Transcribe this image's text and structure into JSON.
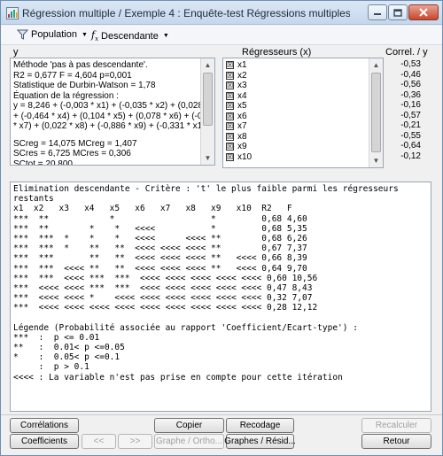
{
  "window": {
    "title": "Régression multiple / Exemple 4 : Enquête-test Régressions multiples (extrait..."
  },
  "toolbar": {
    "population_label": "Population",
    "descendante_label": "Descendante"
  },
  "labels": {
    "y": "y",
    "regresseurs": "Régresseurs (x)",
    "correl": "Correl. / y"
  },
  "info": {
    "lines": [
      "Méthode 'pas à pas descendante'.",
      "R2 = 0,677   F = 4,604   p=0,001",
      "Statistique de Durbin-Watson = 1,78",
      "Équation de la régression :",
      "y = 8,246 + (-0,003 * x1) + (-0,035 * x2) + (0,028 * x3)",
      "+ (-0,464 * x4) + (0,104 * x5) + (0,078 * x6) + (-0,264",
      "* x7) + (0,022 * x8) + (-0,886 * x9) + (-0,331 * x10)",
      "",
      "SCreg = 14,075   MCreg = 1,407",
      "SCres = 6,725   MCres = 0,306",
      "SCtot = 20,800"
    ]
  },
  "regressors": [
    {
      "name": "x1",
      "corr": "-0,53"
    },
    {
      "name": "x2",
      "corr": "-0,46"
    },
    {
      "name": "x3",
      "corr": "-0,56"
    },
    {
      "name": "x4",
      "corr": "-0,36"
    },
    {
      "name": "x5",
      "corr": "-0,16"
    },
    {
      "name": "x6",
      "corr": "-0,57"
    },
    {
      "name": "x7",
      "corr": "-0,21"
    },
    {
      "name": "x8",
      "corr": "-0,55"
    },
    {
      "name": "x9",
      "corr": "-0,64"
    },
    {
      "name": "x10",
      "corr": "-0,12"
    }
  ],
  "checkbox_mark": "☒",
  "output": {
    "lines": [
      "Elimination descendante - Critère : 't' le plus faible parmi les régresseurs",
      "restants",
      "x1  x2   x3   x4   x5   x6   x7   x8   x9   x10  R2   F",
      "***  **            *                   *         0,68 4,60",
      "***  **        *    *   <<<<           *         0,68 5,35",
      "***  ***  *    *    *   <<<<      <<<< **        0,68 6,26",
      "***  ***  *    **   **  <<<< <<<< <<<< **        0,67 7,37",
      "***  ***       **   **  <<<< <<<< <<<< **   <<<< 0,66 8,39",
      "***  ***  <<<< **   **  <<<< <<<< <<<< **   <<<< 0,64 9,70",
      "***  ***  <<<< ***  ***  <<<< <<<< <<<< <<<< <<<< 0,60 10,56",
      "***  <<<< <<<< ***  ***  <<<< <<<< <<<< <<<< <<<< 0,47 8,43",
      "***  <<<< <<<< *    <<<< <<<< <<<< <<<< <<<< <<<< 0,32 7,07",
      "***  <<<< <<<< <<<< <<<< <<<< <<<< <<<< <<<< <<<< 0,28 12,12",
      "",
      "Légende (Probabilité associée au rapport 'Coefficient/Ecart-type') :",
      "***  :  p <= 0.01",
      "**   :  0.01< p <=0.05",
      "*    :  0.05< p <=0.1",
      "     :  p > 0.1",
      "<<<< : La variable n'est pas prise en compte pour cette itération"
    ]
  },
  "buttons": {
    "correlations": "Corrélations",
    "copier": "Copier",
    "recodage": "Recodage",
    "recalculer": "Recalculer",
    "coefficients": "Coefficients",
    "prev": "<<",
    "next": ">>",
    "graphe_ortho": "Graphe / Ortho...",
    "graphes_resid": "Graphes / Résid...",
    "retour": "Retour"
  }
}
